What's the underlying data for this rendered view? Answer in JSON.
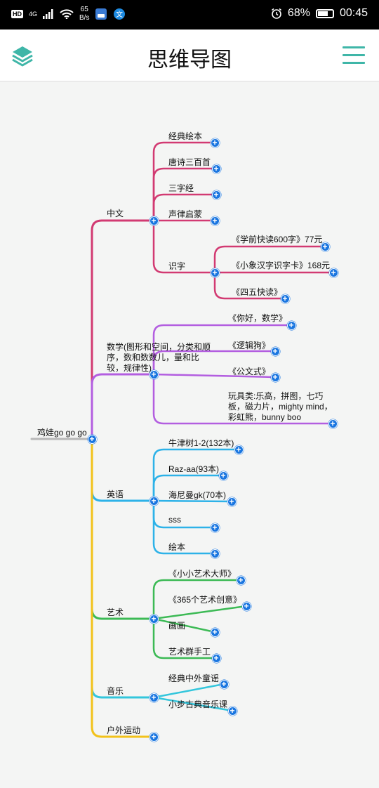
{
  "status_bar": {
    "hd": "HD",
    "network": "4G",
    "speed_value": "65",
    "speed_unit": "B/s",
    "battery": "68%",
    "time": "00:45"
  },
  "header": {
    "title": "思维导图",
    "left_icon": "layers-icon",
    "right_icon": "menu-icon"
  },
  "mindmap": {
    "root": "鸡娃go go go",
    "branches": [
      {
        "label": "中文",
        "color": "#d23a72",
        "children": [
          {
            "label": "经典绘本"
          },
          {
            "label": "唐诗三百首"
          },
          {
            "label": "三字经"
          },
          {
            "label": "声律启蒙"
          },
          {
            "label": "识字",
            "children": [
              {
                "label": "《学前快读600字》77元"
              },
              {
                "label": "《小象汉字识字卡》168元"
              },
              {
                "label": "《四五快读》"
              }
            ]
          }
        ]
      },
      {
        "label": "数学(图形和空间，分类和顺序，数和数数儿，量和比较，规律性)",
        "color": "#b35ee0",
        "children": [
          {
            "label": "《你好，数学》"
          },
          {
            "label": "《逻辑狗》"
          },
          {
            "label": "《公文式》"
          },
          {
            "label": "玩具类:乐高，拼图，七巧板，磁力片，mighty mind，彩虹熊，bunny boo"
          }
        ]
      },
      {
        "label": "英语",
        "color": "#2db2e8",
        "children": [
          {
            "label": "牛津树1-2(132本)"
          },
          {
            "label": "Raz-aa(93本)"
          },
          {
            "label": "海尼曼gk(70本)"
          },
          {
            "label": "sss"
          },
          {
            "label": "绘本"
          }
        ]
      },
      {
        "label": "艺术",
        "color": "#3cba55",
        "children": [
          {
            "label": "《小小艺术大师》"
          },
          {
            "label": "《365个艺术创意》"
          },
          {
            "label": "画画"
          },
          {
            "label": "艺术群手工"
          }
        ]
      },
      {
        "label": "音乐",
        "color": "#33c6dc",
        "children": [
          {
            "label": "经典中外童谣"
          },
          {
            "label": "小步古典音乐课"
          }
        ]
      },
      {
        "label": "户外运动",
        "color": "#f2c21a",
        "children": []
      }
    ]
  },
  "colors": {
    "accent": "#3fb6a8",
    "node_button": "#1a76e0",
    "root_line": "#b8b8b8",
    "background": "#f4f5f4"
  }
}
